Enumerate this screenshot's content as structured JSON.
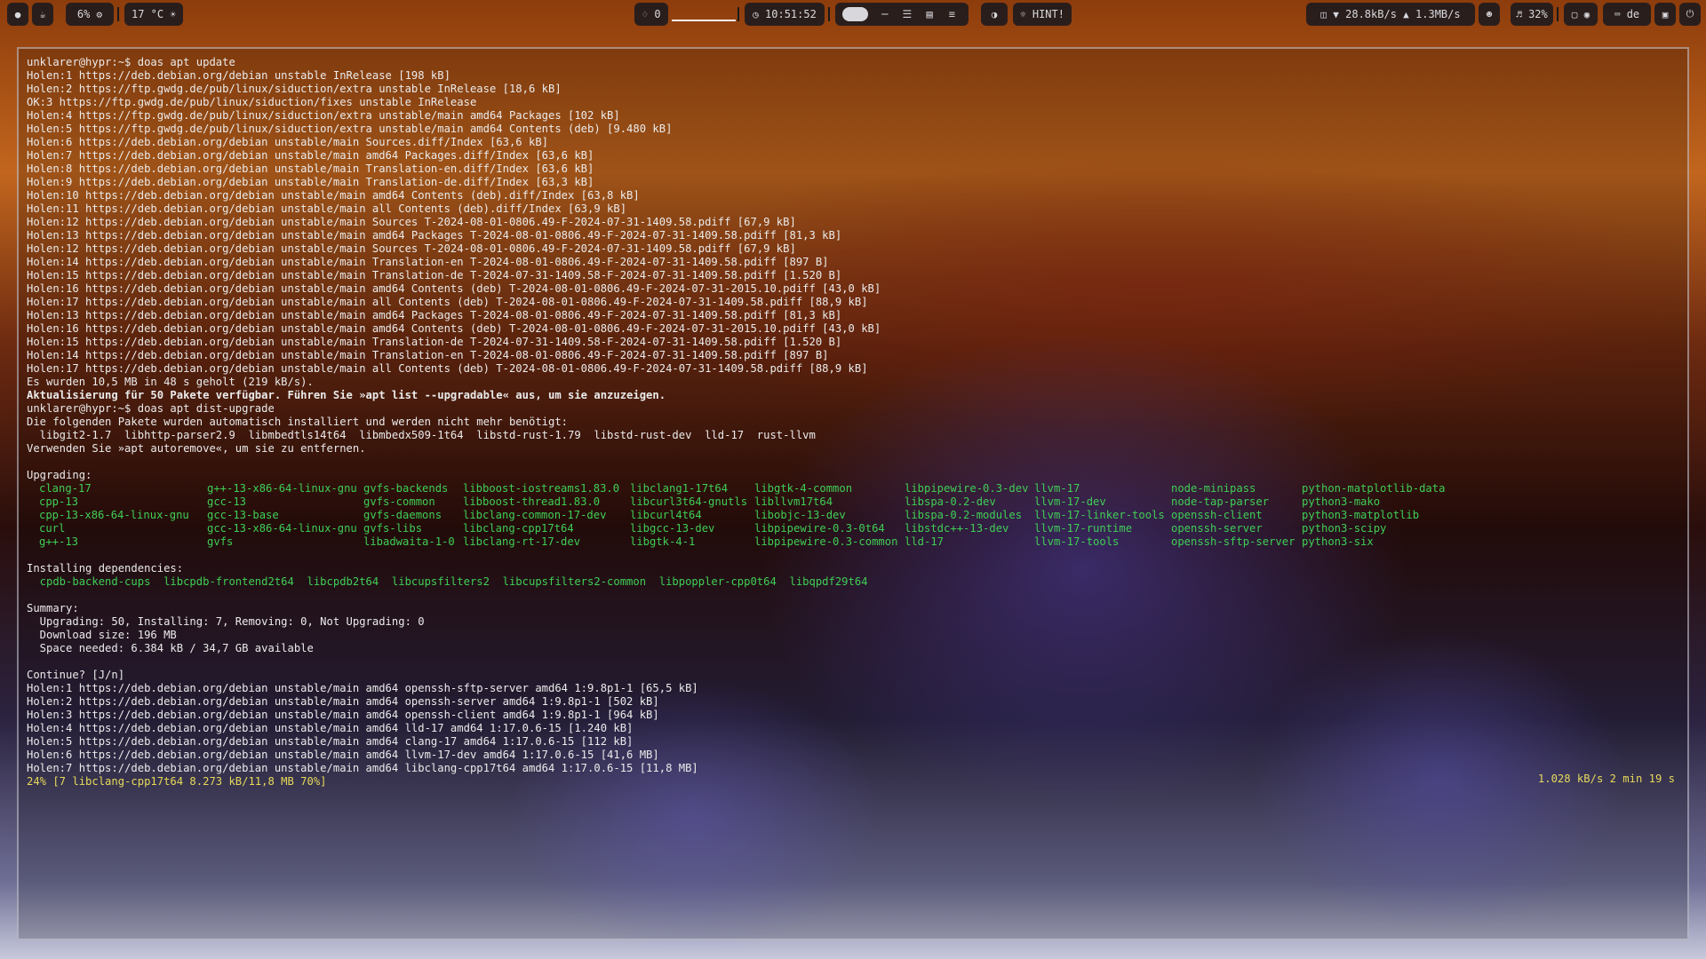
{
  "topbar": {
    "cpu": "6%",
    "temperature": "17 °C",
    "notifications": "0",
    "clock": "10:51:52",
    "hint": "HINT!",
    "net_down": "28.8kB/s",
    "net_up": "1.3MB/s",
    "volume": "32%",
    "keyboard_layout": "de"
  },
  "terminal": {
    "lines": [
      {
        "t": "unklarer@hypr:~$ doas apt update"
      },
      {
        "t": "Holen:1 https://deb.debian.org/debian unstable InRelease [198 kB]"
      },
      {
        "t": "Holen:2 https://ftp.gwdg.de/pub/linux/siduction/extra unstable InRelease [18,6 kB]"
      },
      {
        "t": "OK:3 https://ftp.gwdg.de/pub/linux/siduction/fixes unstable InRelease"
      },
      {
        "t": "Holen:4 https://ftp.gwdg.de/pub/linux/siduction/extra unstable/main amd64 Packages [102 kB]"
      },
      {
        "t": "Holen:5 https://ftp.gwdg.de/pub/linux/siduction/extra unstable/main amd64 Contents (deb) [9.480 kB]"
      },
      {
        "t": "Holen:6 https://deb.debian.org/debian unstable/main Sources.diff/Index [63,6 kB]"
      },
      {
        "t": "Holen:7 https://deb.debian.org/debian unstable/main amd64 Packages.diff/Index [63,6 kB]"
      },
      {
        "t": "Holen:8 https://deb.debian.org/debian unstable/main Translation-en.diff/Index [63,6 kB]"
      },
      {
        "t": "Holen:9 https://deb.debian.org/debian unstable/main Translation-de.diff/Index [63,3 kB]"
      },
      {
        "t": "Holen:10 https://deb.debian.org/debian unstable/main amd64 Contents (deb).diff/Index [63,8 kB]"
      },
      {
        "t": "Holen:11 https://deb.debian.org/debian unstable/main all Contents (deb).diff/Index [63,9 kB]"
      },
      {
        "t": "Holen:12 https://deb.debian.org/debian unstable/main Sources T-2024-08-01-0806.49-F-2024-07-31-1409.58.pdiff [67,9 kB]"
      },
      {
        "t": "Holen:13 https://deb.debian.org/debian unstable/main amd64 Packages T-2024-08-01-0806.49-F-2024-07-31-1409.58.pdiff [81,3 kB]"
      },
      {
        "t": "Holen:12 https://deb.debian.org/debian unstable/main Sources T-2024-08-01-0806.49-F-2024-07-31-1409.58.pdiff [67,9 kB]"
      },
      {
        "t": "Holen:14 https://deb.debian.org/debian unstable/main Translation-en T-2024-08-01-0806.49-F-2024-07-31-1409.58.pdiff [897 B]"
      },
      {
        "t": "Holen:15 https://deb.debian.org/debian unstable/main Translation-de T-2024-07-31-1409.58-F-2024-07-31-1409.58.pdiff [1.520 B]"
      },
      {
        "t": "Holen:16 https://deb.debian.org/debian unstable/main amd64 Contents (deb) T-2024-08-01-0806.49-F-2024-07-31-2015.10.pdiff [43,0 kB]"
      },
      {
        "t": "Holen:17 https://deb.debian.org/debian unstable/main all Contents (deb) T-2024-08-01-0806.49-F-2024-07-31-1409.58.pdiff [88,9 kB]"
      },
      {
        "t": "Holen:13 https://deb.debian.org/debian unstable/main amd64 Packages T-2024-08-01-0806.49-F-2024-07-31-1409.58.pdiff [81,3 kB]"
      },
      {
        "t": "Holen:16 https://deb.debian.org/debian unstable/main amd64 Contents (deb) T-2024-08-01-0806.49-F-2024-07-31-2015.10.pdiff [43,0 kB]"
      },
      {
        "t": "Holen:15 https://deb.debian.org/debian unstable/main Translation-de T-2024-07-31-1409.58-F-2024-07-31-1409.58.pdiff [1.520 B]"
      },
      {
        "t": "Holen:14 https://deb.debian.org/debian unstable/main Translation-en T-2024-08-01-0806.49-F-2024-07-31-1409.58.pdiff [897 B]"
      },
      {
        "t": "Holen:17 https://deb.debian.org/debian unstable/main all Contents (deb) T-2024-08-01-0806.49-F-2024-07-31-1409.58.pdiff [88,9 kB]"
      },
      {
        "t": "Es wurden 10,5 MB in 48 s geholt (219 kB/s)."
      },
      {
        "t": "Aktualisierung für 50 Pakete verfügbar. Führen Sie »apt list --upgradable« aus, um sie anzuzeigen.",
        "s": "b"
      },
      {
        "t": "unklarer@hypr:~$ doas apt dist-upgrade"
      },
      {
        "t": "Die folgenden Pakete wurden automatisch installiert und werden nicht mehr benötigt:"
      },
      {
        "t": "  libgit2-1.7  libhttp-parser2.9  libmbedtls14t64  libmbedx509-1t64  libstd-rust-1.79  libstd-rust-dev  lld-17  rust-llvm"
      },
      {
        "t": "Verwenden Sie »apt autoremove«, um sie zu entfernen."
      },
      {
        "t": ""
      },
      {
        "t": "Upgrading:"
      }
    ],
    "upgrading_columns": [
      [
        "clang-17",
        "cpp-13",
        "cpp-13-x86-64-linux-gnu",
        "curl",
        "g++-13"
      ],
      [
        "g++-13-x86-64-linux-gnu",
        "gcc-13",
        "gcc-13-base",
        "gcc-13-x86-64-linux-gnu",
        "gvfs"
      ],
      [
        "gvfs-backends",
        "gvfs-common",
        "gvfs-daemons",
        "gvfs-libs",
        "libadwaita-1-0"
      ],
      [
        "libboost-iostreams1.83.0",
        "libboost-thread1.83.0",
        "libclang-common-17-dev",
        "libclang-cpp17t64",
        "libclang-rt-17-dev"
      ],
      [
        "libclang1-17t64",
        "libcurl3t64-gnutls",
        "libcurl4t64",
        "libgcc-13-dev",
        "libgtk-4-1"
      ],
      [
        "libgtk-4-common",
        "libllvm17t64",
        "libobjc-13-dev",
        "libpipewire-0.3-0t64",
        "libpipewire-0.3-common"
      ],
      [
        "libpipewire-0.3-dev",
        "libspa-0.2-dev",
        "libspa-0.2-modules",
        "libstdc++-13-dev",
        "lld-17"
      ],
      [
        "llvm-17",
        "llvm-17-dev",
        "llvm-17-linker-tools",
        "llvm-17-runtime",
        "llvm-17-tools"
      ],
      [
        "node-minipass",
        "node-tap-parser",
        "openssh-client",
        "openssh-server",
        "openssh-sftp-server"
      ],
      [
        "python-matplotlib-data",
        "python3-mako",
        "python3-matplotlib",
        "python3-scipy",
        "python3-six"
      ]
    ],
    "lines_after": [
      {
        "t": ""
      },
      {
        "t": "Installing dependencies:"
      },
      {
        "t": "  cpdb-backend-cups  libcpdb-frontend2t64  libcpdb2t64  libcupsfilters2  libcupsfilters2-common  libpoppler-cpp0t64  libqpdf29t64",
        "s": "g"
      },
      {
        "t": ""
      },
      {
        "t": "Summary:"
      },
      {
        "t": "  Upgrading: 50, Installing: 7, Removing: 0, Not Upgrading: 0"
      },
      {
        "t": "  Download size: 196 MB"
      },
      {
        "t": "  Space needed: 6.384 kB / 34,7 GB available"
      },
      {
        "t": ""
      },
      {
        "t": "Continue? [J/n]"
      },
      {
        "t": "Holen:1 https://deb.debian.org/debian unstable/main amd64 openssh-sftp-server amd64 1:9.8p1-1 [65,5 kB]"
      },
      {
        "t": "Holen:2 https://deb.debian.org/debian unstable/main amd64 openssh-server amd64 1:9.8p1-1 [502 kB]"
      },
      {
        "t": "Holen:3 https://deb.debian.org/debian unstable/main amd64 openssh-client amd64 1:9.8p1-1 [964 kB]"
      },
      {
        "t": "Holen:4 https://deb.debian.org/debian unstable/main amd64 lld-17 amd64 1:17.0.6-15 [1.240 kB]"
      },
      {
        "t": "Holen:5 https://deb.debian.org/debian unstable/main amd64 clang-17 amd64 1:17.0.6-15 [112 kB]"
      },
      {
        "t": "Holen:6 https://deb.debian.org/debian unstable/main amd64 llvm-17-dev amd64 1:17.0.6-15 [41,6 MB]"
      },
      {
        "t": "Holen:7 https://deb.debian.org/debian unstable/main amd64 libclang-cpp17t64 amd64 1:17.0.6-15 [11,8 MB]"
      },
      {
        "t": "24% [7 libclang-cpp17t64 8.273 kB/11,8 MB 70%]",
        "s": "y"
      }
    ],
    "progress_rate": "1.028 kB/s 2 min 19 s"
  },
  "colors": {
    "text": "#ebebeb",
    "package_green": "#3fce55",
    "progress_yellow": "#e7d95a",
    "bar_bg": "#18181e"
  }
}
